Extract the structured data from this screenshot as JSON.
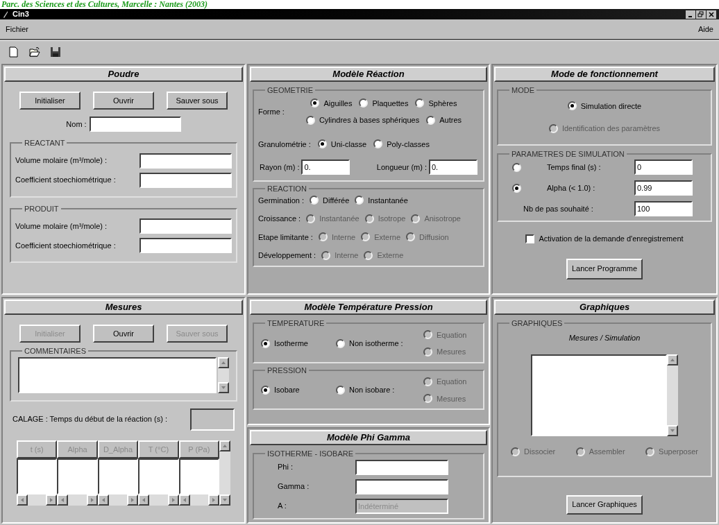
{
  "caption": "Parc. des Sciences et des Cultures, Marcelle : Nantes (2003)",
  "window": {
    "title": "Cin3"
  },
  "menu": [
    {
      "label": "Fichier"
    },
    {
      "label": "Aide"
    }
  ],
  "toolbar": [
    {
      "kind": "new"
    },
    {
      "kind": "open"
    },
    {
      "kind": "save"
    }
  ],
  "poudre": {
    "title": "Poudre",
    "buttons": [
      {
        "label": "Initialiser",
        "disabled": false
      },
      {
        "label": "Ouvrir",
        "disabled": false
      },
      {
        "label": "Sauver sous",
        "disabled": false
      }
    ],
    "name_label": "Nom :",
    "groups": [
      {
        "title": "REACTANT",
        "fields": [
          {
            "label": "Volume molaire (m³/mole) :"
          },
          {
            "label": "Coefficient stoechiométrique :"
          }
        ]
      },
      {
        "title": "PRODUIT",
        "fields": [
          {
            "label": "Volume molaire (m³/mole) :"
          },
          {
            "label": "Coefficient stoechiométrique :"
          }
        ]
      }
    ]
  },
  "modele_reaction": {
    "title": "Modèle Réaction",
    "geometrie": {
      "title": "GEOMETRIE",
      "forme_label": "Forme :",
      "forme_rows": [
        [
          {
            "label": "Aiguilles",
            "selected": true
          },
          {
            "label": "Plaquettes",
            "selected": false
          },
          {
            "label": "Sphères",
            "selected": false
          }
        ],
        [
          {
            "label": "Cylindres à bases sphériques",
            "selected": false
          },
          {
            "label": "Autres",
            "selected": false
          }
        ]
      ],
      "granulo_label": "Granulométrie :",
      "granulo_options": [
        {
          "label": "Uni-classe",
          "selected": true
        },
        {
          "label": "Poly-classes",
          "selected": false
        }
      ],
      "fields": [
        {
          "label": "Rayon (m) :",
          "value": "0."
        },
        {
          "label": "Longueur (m) :",
          "value": "0."
        }
      ]
    },
    "reaction": {
      "title": "REACTION",
      "rows": [
        {
          "label": "Germination :",
          "options": [
            {
              "label": "Différée",
              "selected": false,
              "disabled": false
            },
            {
              "label": "Instantanée",
              "selected": false,
              "disabled": false
            }
          ]
        },
        {
          "label": "Croissance :",
          "options": [
            {
              "label": "Instantanée",
              "selected": false,
              "disabled": true
            },
            {
              "label": "Isotrope",
              "selected": false,
              "disabled": true
            },
            {
              "label": "Anisotrope",
              "selected": false,
              "disabled": true
            }
          ]
        },
        {
          "label": "Etape limitante :",
          "options": [
            {
              "label": "Interne",
              "selected": false,
              "disabled": true
            },
            {
              "label": "Externe",
              "selected": false,
              "disabled": true
            },
            {
              "label": "Diffusion",
              "selected": false,
              "disabled": true
            }
          ]
        },
        {
          "label": "Développement :",
          "options": [
            {
              "label": "Interne",
              "selected": false,
              "disabled": true
            },
            {
              "label": "Externe",
              "selected": false,
              "disabled": true
            }
          ]
        }
      ]
    }
  },
  "mode": {
    "title": "Mode de fonctionnement",
    "mode_group": {
      "title": "MODE",
      "options": [
        {
          "label": "Simulation directe",
          "selected": true,
          "disabled": false
        },
        {
          "label": "Identification des paramètres",
          "selected": false,
          "disabled": true
        }
      ]
    },
    "params": {
      "title": "PARAMETRES DE SIMULATION",
      "rows": [
        {
          "kind": "radio",
          "label": "Temps final (s) :",
          "selected": false,
          "value": "0"
        },
        {
          "kind": "radio",
          "label": "Alpha (< 1.0) :",
          "selected": true,
          "value": "0.99"
        },
        {
          "kind": "plain",
          "label": "Nb de pas souhaité :",
          "value": "100"
        }
      ]
    },
    "checkbox": {
      "label": "Activation de la demande d'enregistrement",
      "checked": false
    },
    "button": "Lancer Programme"
  },
  "mesures": {
    "title": "Mesures",
    "buttons": [
      {
        "label": "Initialiser",
        "disabled": true
      },
      {
        "label": "Ouvrir",
        "disabled": false
      },
      {
        "label": "Sauver sous",
        "disabled": true
      }
    ],
    "comments_title": "COMMENTAIRES",
    "calage_label": "CALAGE : Temps du début de la réaction (s) :",
    "table_columns": [
      "t (s)",
      "Alpha",
      "D_Alpha",
      "T (°C)",
      "P (Pa)"
    ]
  },
  "temp_pression": {
    "title": "Modèle Température Pression",
    "groups": [
      {
        "title": "TEMPERATURE",
        "main": {
          "label": "Isotherme",
          "selected": true
        },
        "alt": {
          "label": "Non isotherme :",
          "selected": false
        },
        "sub": [
          {
            "label": "Equation",
            "selected": false,
            "disabled": true
          },
          {
            "label": "Mesures",
            "selected": false,
            "disabled": true
          }
        ]
      },
      {
        "title": "PRESSION",
        "main": {
          "label": "Isobare",
          "selected": true
        },
        "alt": {
          "label": "Non isobare :",
          "selected": false
        },
        "sub": [
          {
            "label": "Equation",
            "selected": false,
            "disabled": true
          },
          {
            "label": "Mesures",
            "selected": false,
            "disabled": true
          }
        ]
      }
    ]
  },
  "phi_gamma": {
    "title": "Modèle Phi Gamma",
    "group_title": "ISOTHERME - ISOBARE",
    "fields": [
      {
        "label": "Phi :",
        "disabled": false
      },
      {
        "label": "Gamma :",
        "disabled": false
      },
      {
        "label": "A :",
        "value": "Indéterminé",
        "disabled": true
      }
    ]
  },
  "graphiques": {
    "title": "Graphiques",
    "group_title": "GRAPHIQUES",
    "list_title": "Mesures / Simulation",
    "options": [
      {
        "label": "Dissocier",
        "selected": false,
        "disabled": true
      },
      {
        "label": "Assembler",
        "selected": false,
        "disabled": true
      },
      {
        "label": "Superposer",
        "selected": false,
        "disabled": true
      }
    ],
    "button": "Lancer Graphiques"
  }
}
